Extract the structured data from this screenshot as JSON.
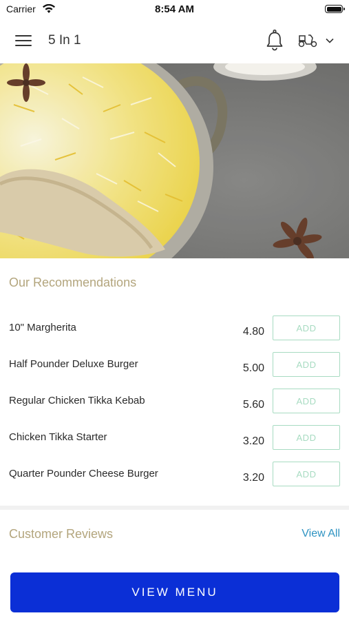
{
  "status_bar": {
    "carrier": "Carrier",
    "time": "8:54 AM"
  },
  "header": {
    "title": "5 In 1",
    "icons": [
      "hamburger-menu-icon",
      "bell-icon",
      "scooter-icon",
      "chevron-down-icon"
    ]
  },
  "hero": {
    "image": "biryani-dish-photo"
  },
  "recommendations": {
    "title": "Our Recommendations",
    "add_label": "ADD",
    "items": [
      {
        "name": "10\" Margherita",
        "price": "4.80"
      },
      {
        "name": "Half Pounder Deluxe Burger",
        "price": "5.00"
      },
      {
        "name": "Regular Chicken Tikka Kebab",
        "price": "5.60"
      },
      {
        "name": "Chicken Tikka Starter",
        "price": "3.20"
      },
      {
        "name": "Quarter Pounder Cheese Burger",
        "price": "3.20"
      }
    ]
  },
  "reviews": {
    "title": "Customer Reviews",
    "view_all": "View All"
  },
  "footer": {
    "view_menu": "VIEW MENU"
  },
  "colors": {
    "section_title": "#b3a57d",
    "add_button": "#a7dbc1",
    "link": "#2e93c2",
    "primary_button": "#0b2fd6"
  }
}
